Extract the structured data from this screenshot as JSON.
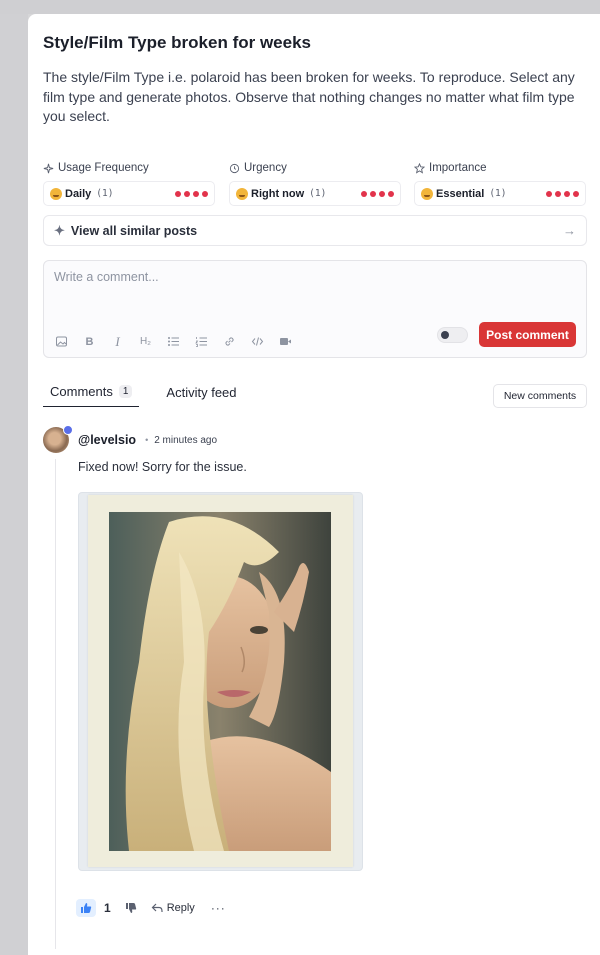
{
  "post": {
    "title": "Style/Film Type broken for weeks",
    "description": "The style/Film Type i.e. polaroid has been broken for weeks. To reproduce. Select any film type and generate photos. Observe that nothing changes no matter what film type you select."
  },
  "meta": [
    {
      "label": "Usage Frequency",
      "icon": "sparkle-icon",
      "value": "Daily",
      "count": "(1)",
      "level": 4
    },
    {
      "label": "Urgency",
      "icon": "clock-icon",
      "value": "Right now",
      "count": "(1)",
      "level": 4
    },
    {
      "label": "Importance",
      "icon": "star-icon",
      "value": "Essential",
      "count": "(1)",
      "level": 4
    }
  ],
  "similar": {
    "label": "View all similar posts"
  },
  "editor": {
    "placeholder": "Write a comment...",
    "post_label": "Post comment",
    "toolbar": [
      "image-icon",
      "bold-icon",
      "italic-icon",
      "heading-icon",
      "bullet-list-icon",
      "numbered-list-icon",
      "link-icon",
      "code-icon",
      "video-icon"
    ]
  },
  "tabs": {
    "comments_label": "Comments",
    "comments_count": "1",
    "activity_label": "Activity feed",
    "new_comments_label": "New comments"
  },
  "comment": {
    "username": "@levelsio",
    "time": "2 minutes ago",
    "text": "Fixed now! Sorry for the issue.",
    "likes": "1",
    "reply_label": "Reply",
    "more_label": "···"
  },
  "colors": {
    "accent_red": "#d93636",
    "dot_red": "#e2334b",
    "verified_blue": "#5a6ee8"
  }
}
